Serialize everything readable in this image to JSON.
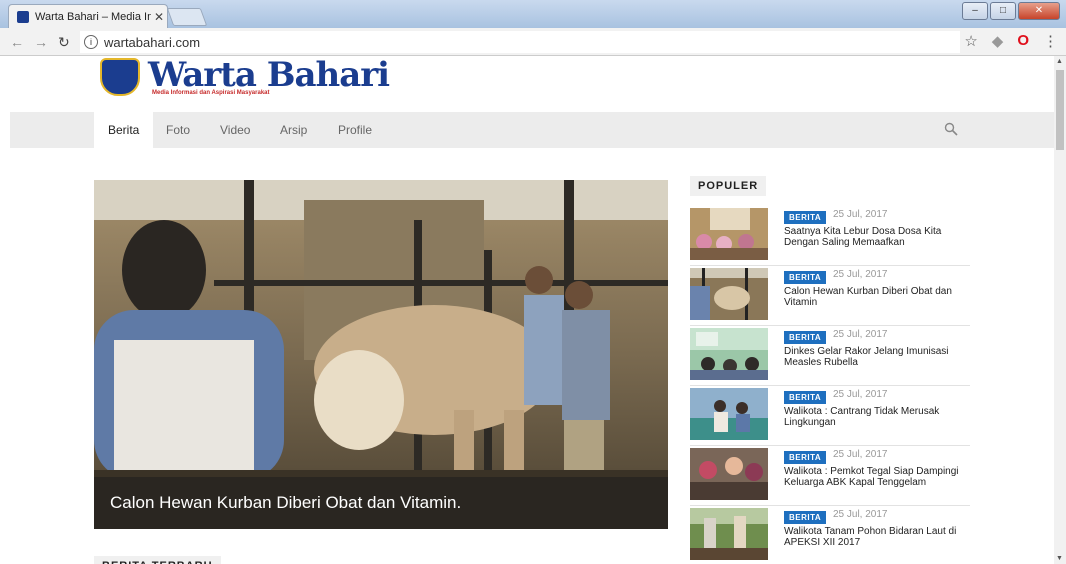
{
  "browser": {
    "tab_title": "Warta Bahari – Media Inf",
    "tab_close": "✕",
    "url": "wartabahari.com",
    "win_minimize": "–",
    "win_maximize": "□",
    "win_close": "✕"
  },
  "site": {
    "name": "Warta Bahari",
    "tagline": "Media Informasi dan Aspirasi Masyarakat",
    "brand_color": "#1b3d8f",
    "accent_color": "#1e6fbf"
  },
  "nav": {
    "items": [
      {
        "label": "Berita",
        "active": true
      },
      {
        "label": "Foto"
      },
      {
        "label": "Video"
      },
      {
        "label": "Arsip"
      },
      {
        "label": "Profile"
      }
    ]
  },
  "hero": {
    "caption": "Calon Hewan Kurban Diberi Obat dan Vitamin."
  },
  "popular": {
    "label": "POPULER",
    "items": [
      {
        "category": "BERITA",
        "date": "25 Jul, 2017",
        "title": "Saatnya Kita Lebur Dosa Dosa Kita Dengan Saling Memaafkan"
      },
      {
        "category": "BERITA",
        "date": "25 Jul, 2017",
        "title": "Calon Hewan Kurban Diberi Obat dan Vitamin"
      },
      {
        "category": "BERITA",
        "date": "25 Jul, 2017",
        "title": "Dinkes Gelar Rakor Jelang Imunisasi Measles Rubella"
      },
      {
        "category": "BERITA",
        "date": "25 Jul, 2017",
        "title": "Walikota : Cantrang Tidak Merusak Lingkungan"
      },
      {
        "category": "BERITA",
        "date": "25 Jul, 2017",
        "title": "Walikota : Pemkot Tegal Siap Dampingi Keluarga ABK Kapal Tenggelam"
      },
      {
        "category": "BERITA",
        "date": "25 Jul, 2017",
        "title": "Walikota Tanam Pohon Bidaran Laut di APEKSI XII 2017"
      }
    ]
  },
  "latest": {
    "label": "BERITA TERBARU"
  }
}
